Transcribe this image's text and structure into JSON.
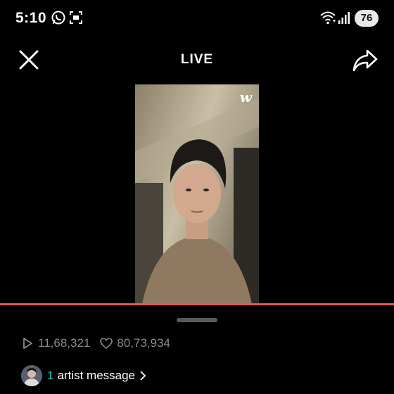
{
  "status_bar": {
    "time": "5:10",
    "battery": "76",
    "icons": [
      "whatsapp-icon",
      "screenshot-icon",
      "wifi-icon",
      "signal-icon"
    ]
  },
  "header": {
    "title": "LIVE",
    "close_icon": "close-icon",
    "share_icon": "share-icon"
  },
  "video": {
    "logo": "w",
    "progress_fraction": 1.0
  },
  "stats": {
    "plays": "11,68,321",
    "likes": "80,73,934"
  },
  "artist_message": {
    "count": "1",
    "label": "artist message"
  },
  "colors": {
    "background": "#000000",
    "progress": "#e25a4e",
    "accent_count": "#19d3c5",
    "stats_text": "#8a8a8a"
  }
}
